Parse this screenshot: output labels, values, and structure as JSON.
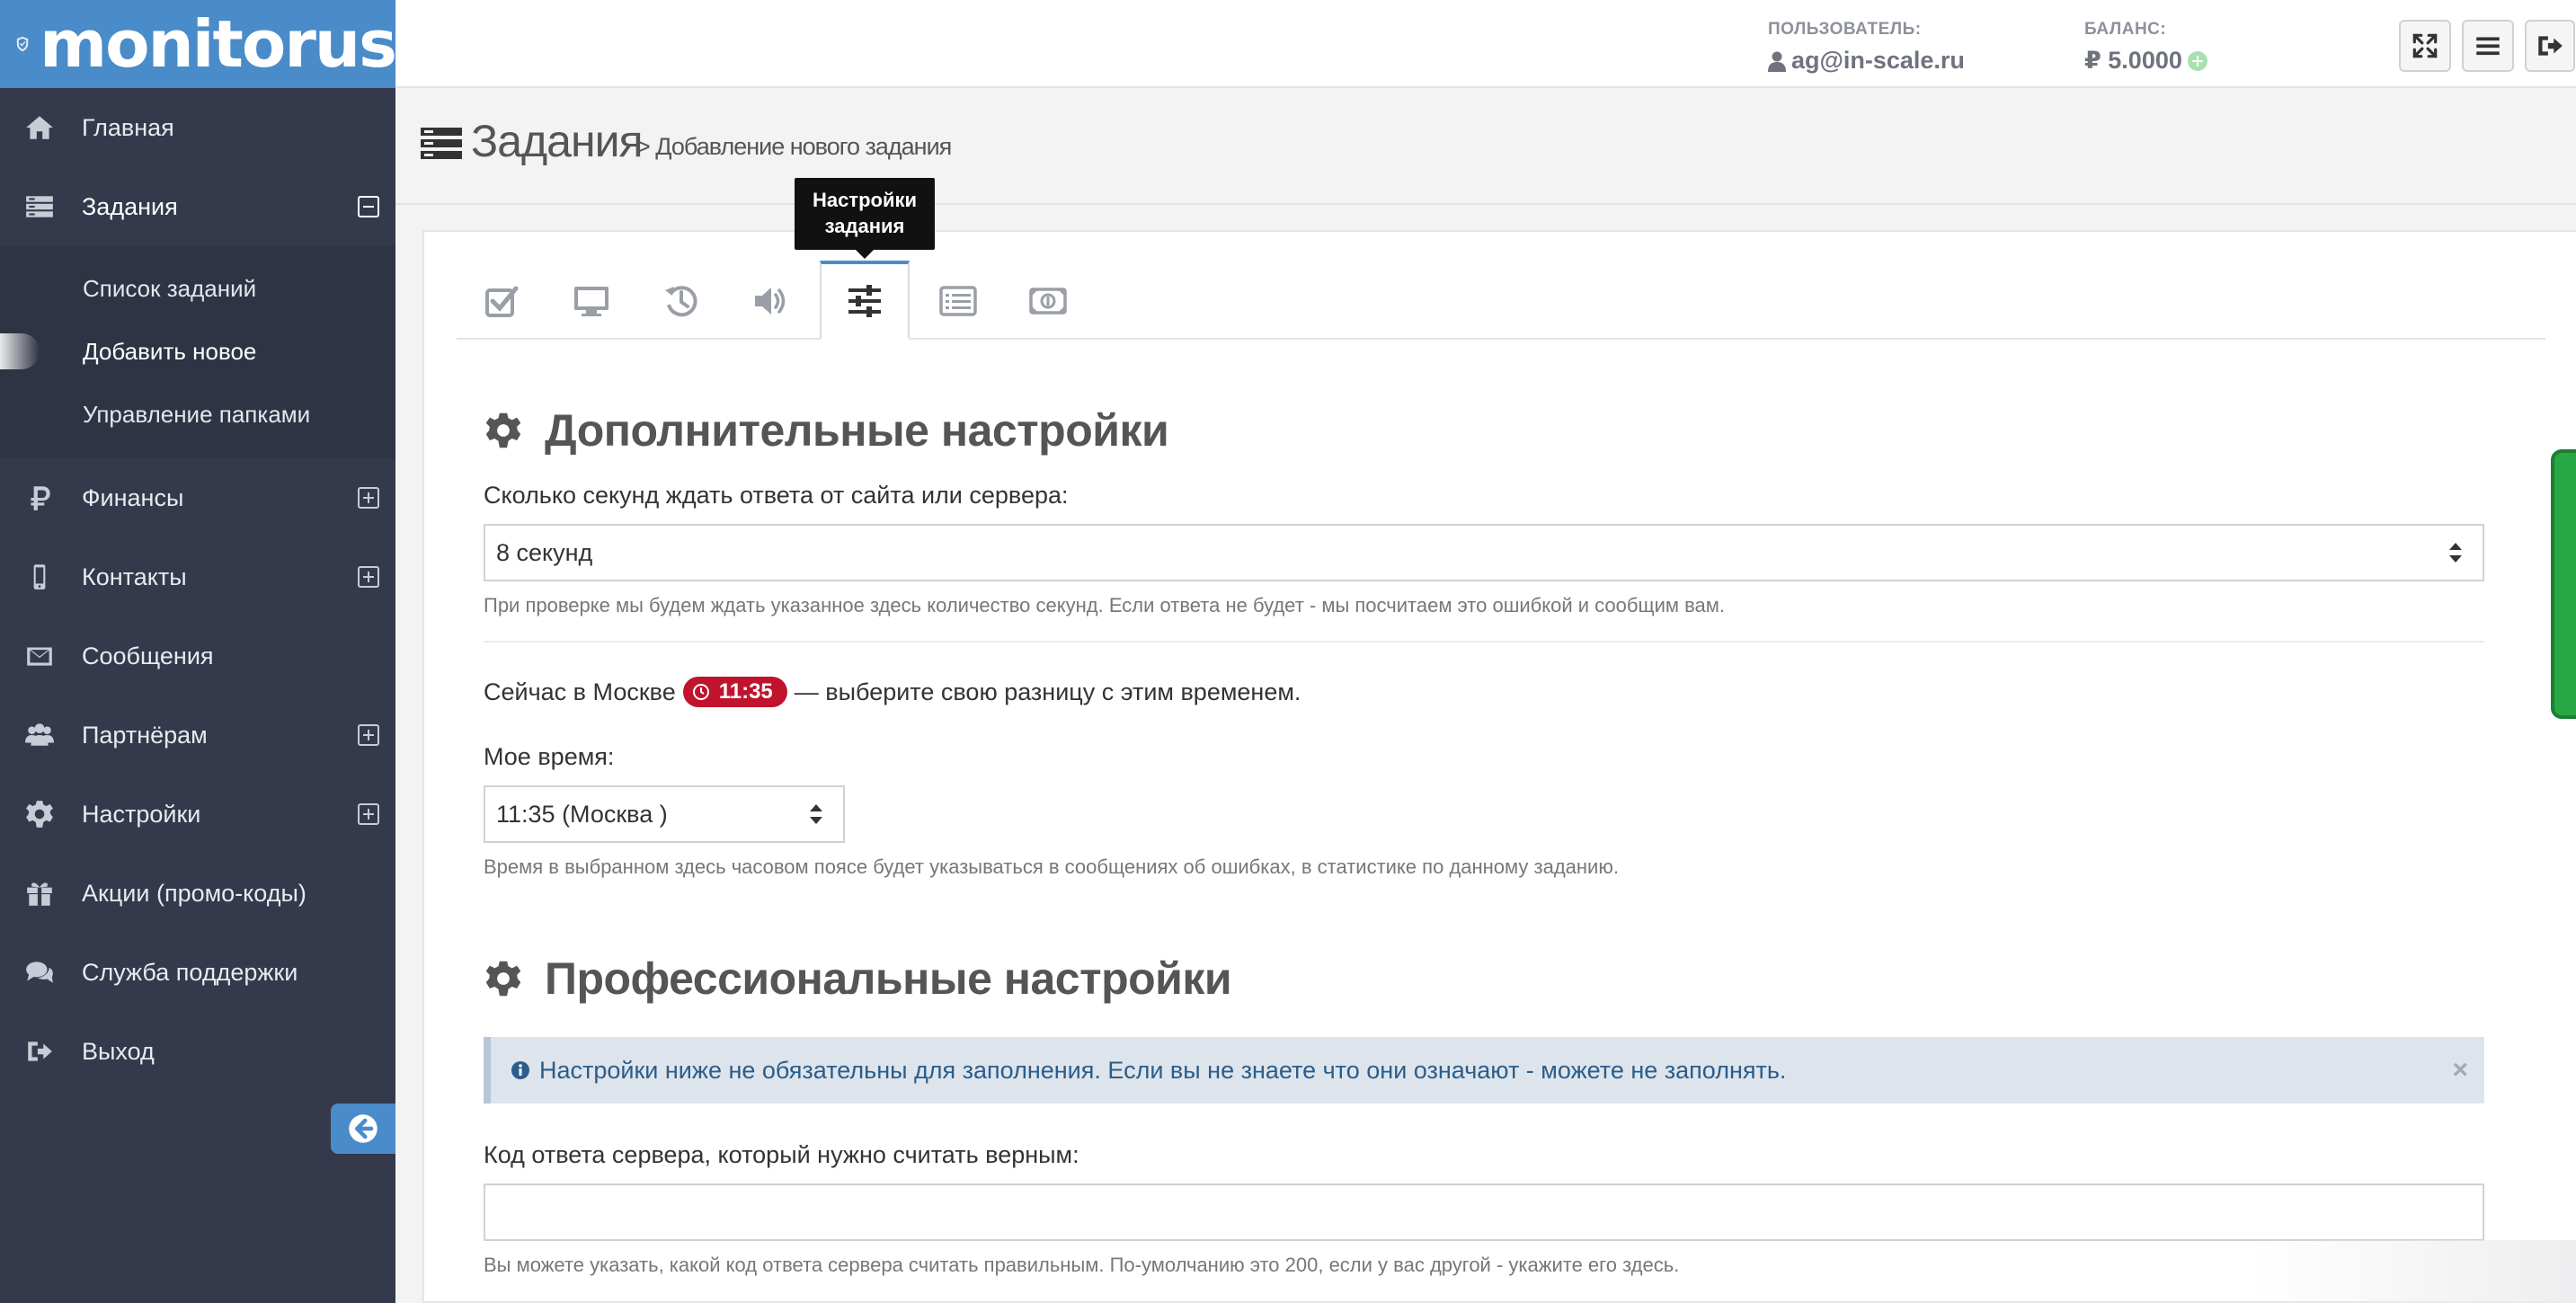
{
  "brand": {
    "name": "monitorus"
  },
  "sidebar": {
    "items": [
      {
        "label": "Главная",
        "icon": "home-icon"
      },
      {
        "label": "Задания",
        "icon": "tasks-icon",
        "expanded": true,
        "sub": [
          {
            "label": "Список заданий"
          },
          {
            "label": "Добавить новое",
            "current": true
          },
          {
            "label": "Управление папками"
          }
        ]
      },
      {
        "label": "Финансы",
        "icon": "ruble-icon",
        "expandable": true
      },
      {
        "label": "Контакты",
        "icon": "phone-icon",
        "expandable": true
      },
      {
        "label": "Сообщения",
        "icon": "envelope-icon"
      },
      {
        "label": "Партнёрам",
        "icon": "users-icon",
        "expandable": true
      },
      {
        "label": "Настройки",
        "icon": "gear-icon",
        "expandable": true
      },
      {
        "label": "Акции (промо-коды)",
        "icon": "gift-icon"
      },
      {
        "label": "Служба поддержки",
        "icon": "comments-icon"
      },
      {
        "label": "Выход",
        "icon": "sign-out-icon"
      }
    ]
  },
  "topbar": {
    "user_label": "ПОЛЬЗОВАТЕЛЬ:",
    "user_value": "ag@in-scale.ru",
    "balance_label": "БАЛАНС:",
    "balance_value": "₽ 5.0000"
  },
  "header": {
    "title": "Задания",
    "breadcrumb": "> Добавление нового задания"
  },
  "tabs": {
    "icons": [
      "check-square-icon",
      "desktop-icon",
      "history-icon",
      "volume-icon",
      "sliders-icon",
      "list-icon",
      "money-icon"
    ],
    "active_index": 4,
    "tooltip": [
      "Настройки",
      "задания"
    ]
  },
  "section_additional": {
    "title": "Дополнительные настройки",
    "timeout_label": "Сколько секунд ждать ответа от сайта или сервера:",
    "timeout_value": "8 секунд",
    "timeout_help": "При проверке мы будем ждать указанное здесь количество секунд. Если ответа не будет - мы посчитаем это ошибкой и сообщим вам.",
    "moscow_prefix": "Сейчас в Москве",
    "moscow_time": "11:35",
    "moscow_suffix": "— выберите свою разницу с этим временем.",
    "my_time_label": "Мое время:",
    "my_time_value": "11:35 (Москва )",
    "my_time_help": "Время в выбранном здесь часовом поясе будет указываться в сообщениях об ошибках, в статистике по данному заданию."
  },
  "section_pro": {
    "title": "Профессиональные настройки",
    "alert": "Настройки ниже не обязательны для заполнения. Если вы не знаете что они означают - можете не заполнять.",
    "alert_close": "×",
    "code_label": "Код ответа сервера, который нужно считать верным:",
    "code_value": "",
    "code_help": "Вы можете указать, какой код ответа сервера считать правильным. По-умолчанию это 200, если у вас другой - укажите его здесь."
  },
  "colors": {
    "sidebar_bg": "#34394b",
    "brand_blue": "#4a8bc9",
    "badge_red": "#c0132d",
    "alert_bg": "#dde4ec",
    "alert_text": "#2b5d8a"
  }
}
